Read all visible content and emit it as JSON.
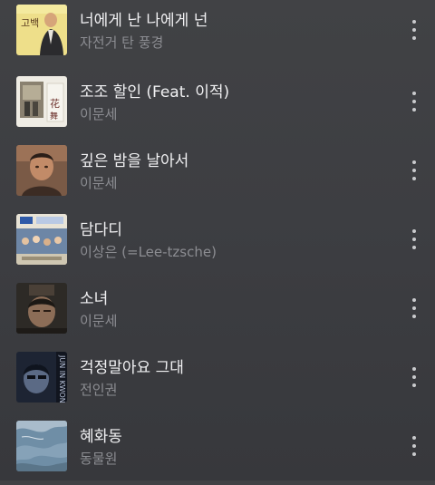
{
  "songs": [
    {
      "title": "너에게 난 나에게 넌",
      "artist": "자전거 탄 풍경",
      "art_icon": "album-art-yellow-portrait"
    },
    {
      "title": "조조 할인 (Feat. 이적)",
      "artist": "이문세",
      "art_icon": "album-art-white-flowers"
    },
    {
      "title": "깊은 밤을 날아서",
      "artist": "이문세",
      "art_icon": "album-art-portrait"
    },
    {
      "title": "담다디",
      "artist": "이상은 (=Lee-tzsche)",
      "art_icon": "album-art-crowd"
    },
    {
      "title": "소녀",
      "artist": "이문세",
      "art_icon": "album-art-dark-portrait"
    },
    {
      "title": "걱정말아요 그대",
      "artist": "전인권",
      "art_icon": "album-art-blue-portrait"
    },
    {
      "title": "혜화동",
      "artist": "동물원",
      "art_icon": "album-art-blue-texture"
    }
  ],
  "more_icon": "more-vertical-icon"
}
